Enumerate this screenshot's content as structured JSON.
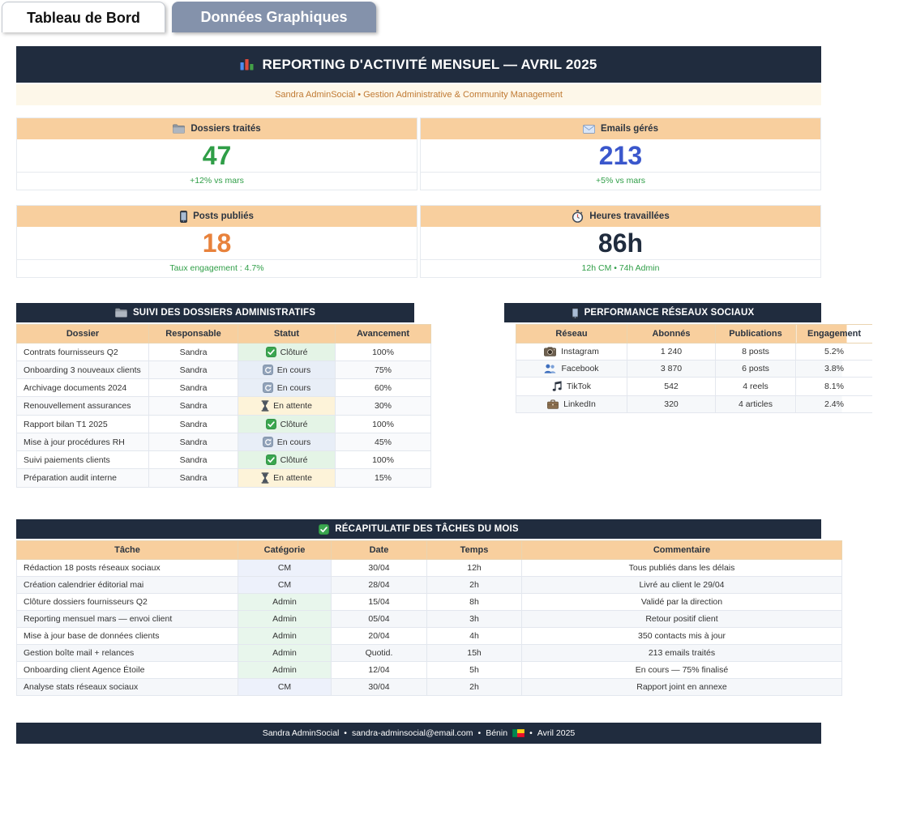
{
  "colors": {
    "navy": "#202c3e",
    "band_tan": "#f8cf9e",
    "cream_bar": "#fdf7e9",
    "subtitle_orange": "#c07a33",
    "green": "#2f9e47",
    "blue": "#3a57cc",
    "orange": "#e8823c",
    "tab_inactive": "#8492ab",
    "status_done_bg": "#e4f4e6",
    "status_progress_bg": "#e8eef7",
    "status_waiting_bg": "#fdf3d9",
    "category_cm_bg": "#edf1fb",
    "category_admin_bg": "#e8f6ec"
  },
  "tabs": [
    {
      "label": "Tableau de Bord",
      "active": true
    },
    {
      "label": "Données Graphiques",
      "active": false
    }
  ],
  "header": {
    "icon": "bar-chart-icon",
    "title": "REPORTING D'ACTIVITÉ MENSUEL — AVRIL 2025",
    "subtitle": "Sandra AdminSocial • Gestion Administrative & Community Management"
  },
  "kpis": [
    {
      "icon": "folder-icon",
      "label": "Dossiers traités",
      "value": "47",
      "value_color": "#2f9e47",
      "footnote": "+12% vs mars"
    },
    {
      "icon": "envelope-icon",
      "label": "Emails gérés",
      "value": "213",
      "value_color": "#3a57cc",
      "footnote": "+5% vs mars"
    },
    {
      "icon": "smartphone-icon",
      "label": "Posts publiés",
      "value": "18",
      "value_color": "#e8823c",
      "footnote": "Taux engagement : 4.7%"
    },
    {
      "icon": "stopwatch-icon",
      "label": "Heures travaillées",
      "value": "86h",
      "value_color": "#202c3e",
      "footnote": "12h CM • 74h Admin"
    }
  ],
  "dossiers_table": {
    "icon": "folder-icon",
    "title": "SUIVI DES DOSSIERS ADMINISTRATIFS",
    "columns": [
      "Dossier",
      "Responsable",
      "Statut",
      "Avancement"
    ],
    "rows": [
      {
        "dossier": "Contrats fournisseurs Q2",
        "responsable": "Sandra",
        "statut": "Clôturé",
        "statut_type": "done",
        "statut_icon": "check-icon",
        "avancement": "100%"
      },
      {
        "dossier": "Onboarding 3 nouveaux clients",
        "responsable": "Sandra",
        "statut": "En cours",
        "statut_type": "progress",
        "statut_icon": "refresh-icon",
        "avancement": "75%"
      },
      {
        "dossier": "Archivage documents 2024",
        "responsable": "Sandra",
        "statut": "En cours",
        "statut_type": "progress",
        "statut_icon": "refresh-icon",
        "avancement": "60%"
      },
      {
        "dossier": "Renouvellement assurances",
        "responsable": "Sandra",
        "statut": "En attente",
        "statut_type": "waiting",
        "statut_icon": "hourglass-icon",
        "avancement": "30%"
      },
      {
        "dossier": "Rapport bilan T1 2025",
        "responsable": "Sandra",
        "statut": "Clôturé",
        "statut_type": "done",
        "statut_icon": "check-icon",
        "avancement": "100%"
      },
      {
        "dossier": "Mise à jour procédures RH",
        "responsable": "Sandra",
        "statut": "En cours",
        "statut_type": "progress",
        "statut_icon": "refresh-icon",
        "avancement": "45%"
      },
      {
        "dossier": "Suivi paiements clients",
        "responsable": "Sandra",
        "statut": "Clôturé",
        "statut_type": "done",
        "statut_icon": "check-icon",
        "avancement": "100%"
      },
      {
        "dossier": "Préparation audit interne",
        "responsable": "Sandra",
        "statut": "En attente",
        "statut_type": "waiting",
        "statut_icon": "hourglass-icon",
        "avancement": "15%"
      }
    ]
  },
  "social_table": {
    "icon": "smartphone-icon",
    "title": "PERFORMANCE RÉSEAUX SOCIAUX",
    "columns": [
      "Réseau",
      "Abonnés",
      "Publications",
      "Engagement"
    ],
    "rows": [
      {
        "icon": "camera-icon",
        "reseau": "Instagram",
        "abonnes": "1 240",
        "publications": "8 posts",
        "engagement": "5.2%"
      },
      {
        "icon": "people-icon",
        "reseau": "Facebook",
        "abonnes": "3 870",
        "publications": "6 posts",
        "engagement": "3.8%"
      },
      {
        "icon": "music-note-icon",
        "reseau": "TikTok",
        "abonnes": "542",
        "publications": "4 reels",
        "engagement": "8.1%"
      },
      {
        "icon": "briefcase-icon",
        "reseau": "LinkedIn",
        "abonnes": "320",
        "publications": "4 articles",
        "engagement": "2.4%"
      }
    ]
  },
  "tasks_table": {
    "icon": "check-icon",
    "title": "RÉCAPITULATIF DES TÂCHES DU MOIS",
    "columns": [
      "Tâche",
      "Catégorie",
      "Date",
      "Temps",
      "Commentaire"
    ],
    "rows": [
      {
        "tache": "Rédaction 18 posts réseaux sociaux",
        "categorie": "CM",
        "date": "30/04",
        "temps": "12h",
        "commentaire": "Tous publiés dans les délais"
      },
      {
        "tache": "Création calendrier éditorial mai",
        "categorie": "CM",
        "date": "28/04",
        "temps": "2h",
        "commentaire": "Livré au client le 29/04"
      },
      {
        "tache": "Clôture dossiers fournisseurs Q2",
        "categorie": "Admin",
        "date": "15/04",
        "temps": "8h",
        "commentaire": "Validé par la direction"
      },
      {
        "tache": "Reporting mensuel mars — envoi client",
        "categorie": "Admin",
        "date": "05/04",
        "temps": "3h",
        "commentaire": "Retour positif client"
      },
      {
        "tache": "Mise à jour base de données clients",
        "categorie": "Admin",
        "date": "20/04",
        "temps": "4h",
        "commentaire": "350 contacts mis à jour"
      },
      {
        "tache": "Gestion boîte mail + relances",
        "categorie": "Admin",
        "date": "Quotid.",
        "temps": "15h",
        "commentaire": "213 emails traités"
      },
      {
        "tache": "Onboarding client Agence Étoile",
        "categorie": "Admin",
        "date": "12/04",
        "temps": "5h",
        "commentaire": "En cours — 75% finalisé"
      },
      {
        "tache": "Analyse stats réseaux sociaux",
        "categorie": "CM",
        "date": "30/04",
        "temps": "2h",
        "commentaire": "Rapport joint en annexe"
      }
    ]
  },
  "footer": {
    "name": "Sandra AdminSocial",
    "email": "sandra-adminsocial@email.com",
    "country": "Bénin",
    "flag_icon": "benin-flag-icon",
    "period": "Avril 2025",
    "separator": "•"
  }
}
